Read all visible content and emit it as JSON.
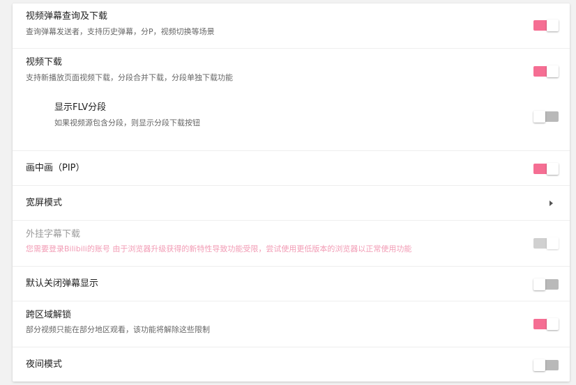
{
  "settings": [
    {
      "title": "视频弹幕查询及下载",
      "description": "查询弹幕发送者，支持历史弹幕，分P，视频切换等场景",
      "state": "on"
    },
    {
      "title": "视频下载",
      "description": "支持新播放页面视频下载，分段合并下载，分段单独下载功能",
      "state": "on"
    },
    {
      "title": "显示FLV分段",
      "description": "如果视频源包含分段，则显示分段下载按钮",
      "state": "off"
    },
    {
      "title": "画中画（PIP）",
      "state": "on"
    },
    {
      "title": "宽屏模式",
      "control": "chevron-right"
    },
    {
      "title": "外挂字幕下载",
      "description": "您需要登录Bilibili的账号    由于浏览器升级获得的新特性导致功能受限，尝试使用更低版本的浏览器以正常使用功能",
      "state": "disabled"
    },
    {
      "title": "默认关闭弹幕显示",
      "state": "off"
    },
    {
      "title": "跨区域解锁",
      "description": "部分视频只能在部分地区观看，该功能将解除这些限制",
      "state": "on"
    },
    {
      "title": "夜间模式",
      "state": "off"
    }
  ],
  "colors": {
    "toggle_on": "#f56e93",
    "toggle_off": "#b9b9b9",
    "toggle_disabled": "#d0d0d0",
    "disabled_description": "#f29cb5"
  }
}
